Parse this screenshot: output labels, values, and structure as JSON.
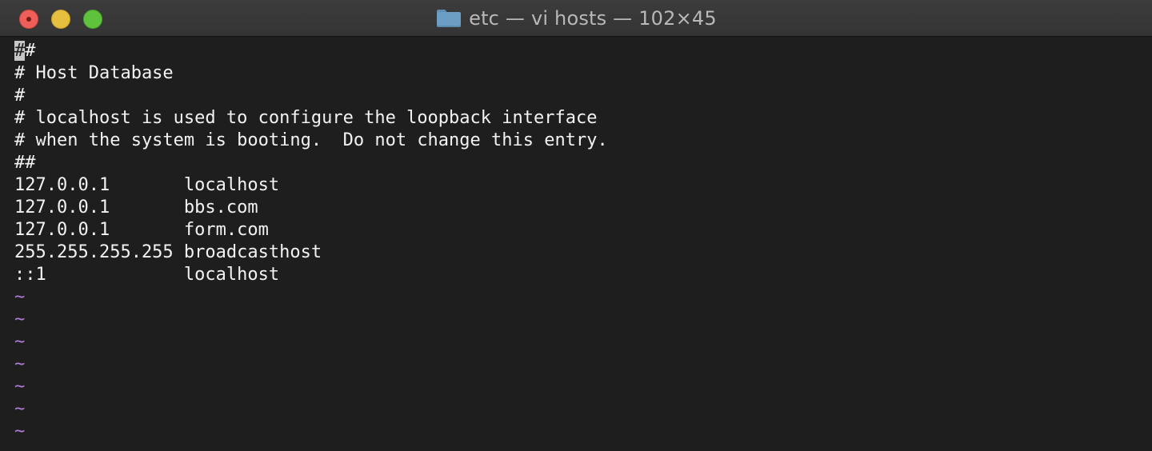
{
  "window": {
    "title": "etc — vi hosts — 102×45",
    "folder_icon": "folder-icon",
    "controls": {
      "close": "close-icon",
      "minimize": "minimize-icon",
      "zoom": "zoom-icon"
    }
  },
  "editor": {
    "cursor_char": "#",
    "lines": [
      "#",
      "# Host Database",
      "#",
      "# localhost is used to configure the loopback interface",
      "# when the system is booting.  Do not change this entry.",
      "##",
      "127.0.0.1       localhost",
      "127.0.0.1       bbs.com",
      "127.0.0.1       form.com",
      "255.255.255.255 broadcasthost",
      "::1             localhost"
    ],
    "empty_line_marker": "~",
    "empty_lines_count": 7,
    "colors": {
      "background": "#1e1e1e",
      "text": "#f2f2f2",
      "tilde": "#b07ad6",
      "cursor": "#c6c6c6"
    }
  }
}
